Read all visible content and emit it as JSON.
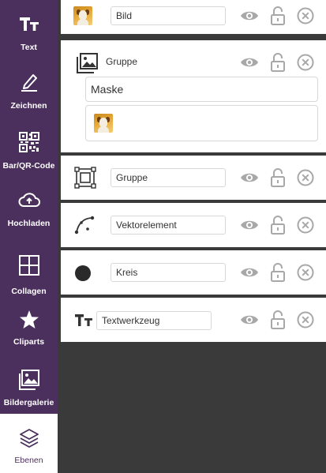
{
  "sidebar": {
    "items": [
      {
        "label": "Text",
        "icon": "text-icon"
      },
      {
        "label": "Zeichnen",
        "icon": "pen-icon"
      },
      {
        "label": "Bar/QR-Code",
        "icon": "qr-code-icon"
      },
      {
        "label": "Hochladen",
        "icon": "cloud-upload-icon"
      },
      {
        "label": "Collagen",
        "icon": "collage-grid-icon"
      },
      {
        "label": "Cliparts",
        "icon": "star-icon"
      },
      {
        "label": "Bildergalerie",
        "icon": "image-gallery-icon"
      },
      {
        "label": "Ebenen",
        "icon": "layers-icon"
      }
    ],
    "active": "Ebenen"
  },
  "layers": [
    {
      "type": "image",
      "icon": "dog-thumbnail",
      "name": "Bild"
    },
    {
      "type": "group-mask",
      "icon": "image-group-icon",
      "name": "Gruppe",
      "mask": {
        "label": "Maske",
        "child_icon": "dog-thumbnail"
      }
    },
    {
      "type": "group",
      "icon": "group-select-icon",
      "name": "Gruppe"
    },
    {
      "type": "vector",
      "icon": "bezier-curve-icon",
      "name": "Vektorelement"
    },
    {
      "type": "circle",
      "icon": "circle-icon",
      "name": "Kreis"
    },
    {
      "type": "text",
      "icon": "text-icon",
      "name": "Textwerkzeug"
    }
  ],
  "layer_actions": [
    "eye-icon",
    "lock-open-icon",
    "close-circle-icon"
  ],
  "colors": {
    "sidebar_bg": "#4b2f5c",
    "panel_bg": "#3a3a3a",
    "action_icon": "#a8a8a8"
  }
}
